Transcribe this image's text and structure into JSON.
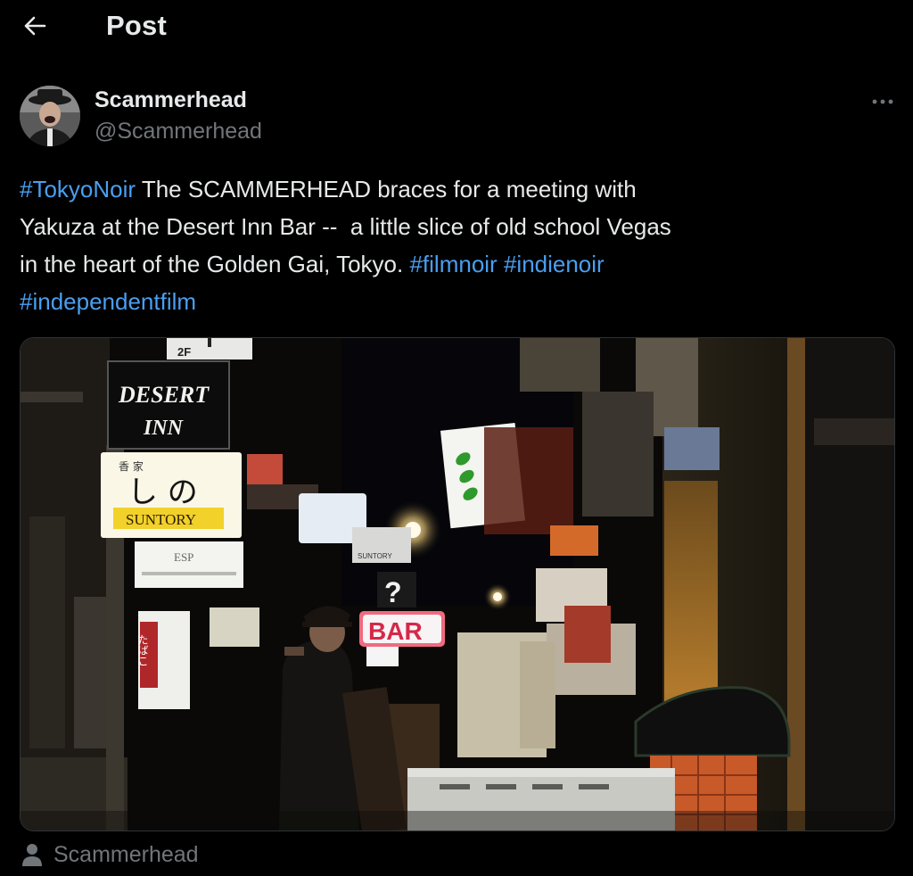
{
  "header": {
    "title": "Post",
    "back_icon": "arrow-left-icon"
  },
  "author": {
    "display_name": "Scammerhead",
    "handle": "@Scammerhead",
    "more_icon": "more-horizontal-icon"
  },
  "tweet": {
    "segments": [
      {
        "text": "#TokyoNoir",
        "type": "hashtag"
      },
      {
        "text": " The SCAMMERHEAD braces for a meeting with\nYakuza at the Desert Inn Bar --  a little slice of old school Vegas\nin the heart of the Golden Gai, Tokyo. ",
        "type": "text"
      },
      {
        "text": "#filmnoir",
        "type": "hashtag"
      },
      {
        "text": " ",
        "type": "text"
      },
      {
        "text": "#indienoir",
        "type": "hashtag"
      },
      {
        "text": "\n",
        "type": "text"
      },
      {
        "text": "#independentfilm",
        "type": "hashtag"
      }
    ]
  },
  "media": {
    "signs": {
      "floor": "2F",
      "desert_inn_line1": "DESERT",
      "desert_inn_line2": "INN",
      "shino_small": "香 家",
      "shino_main": "し の",
      "suntory": "SUNTORY",
      "esp": "ESP",
      "bar": "BAR",
      "question": "?",
      "tabako": "たばこ",
      "suntory_small": "SUNTORY"
    }
  },
  "tagged_user": {
    "name": "Scammerhead",
    "icon": "person-icon"
  },
  "colors": {
    "background": "#000000",
    "text": "#e7e9ea",
    "secondary": "#71767b",
    "link": "#4a9ff0"
  }
}
